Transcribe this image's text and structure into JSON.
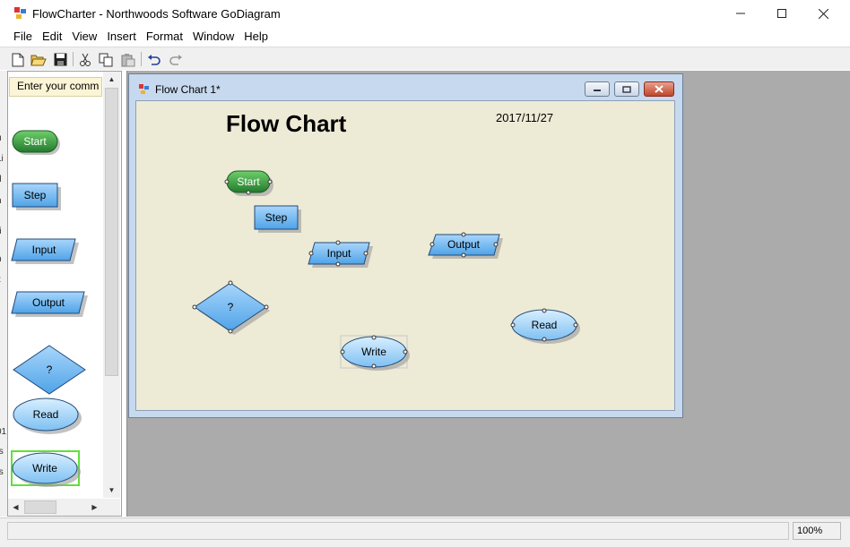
{
  "window": {
    "title": "FlowCharter - Northwoods Software GoDiagram"
  },
  "menu": [
    "File",
    "Edit",
    "View",
    "Insert",
    "Format",
    "Window",
    "Help"
  ],
  "toolbar": [
    "new-icon",
    "open-icon",
    "save-icon",
    "cut-icon",
    "copy-icon",
    "paste-icon",
    "undo-icon",
    "redo-icon"
  ],
  "palette": {
    "comment_placeholder": "Enter your comm",
    "items": [
      "Start",
      "Step",
      "Input",
      "Output",
      "?",
      "Read",
      "Write"
    ]
  },
  "document": {
    "window_title": "Flow Chart 1*",
    "title": "Flow Chart",
    "date": "2017/11/27",
    "nodes": [
      "Start",
      "Step",
      "Input",
      "Output",
      "?",
      "Write",
      "Read"
    ]
  },
  "status": {
    "zoom": "100%"
  },
  "colors": {
    "node_blue": "#6ab4f0",
    "node_green": "#3aa34a",
    "canvas": "#edebd6",
    "mdi_bg": "#ababab"
  }
}
